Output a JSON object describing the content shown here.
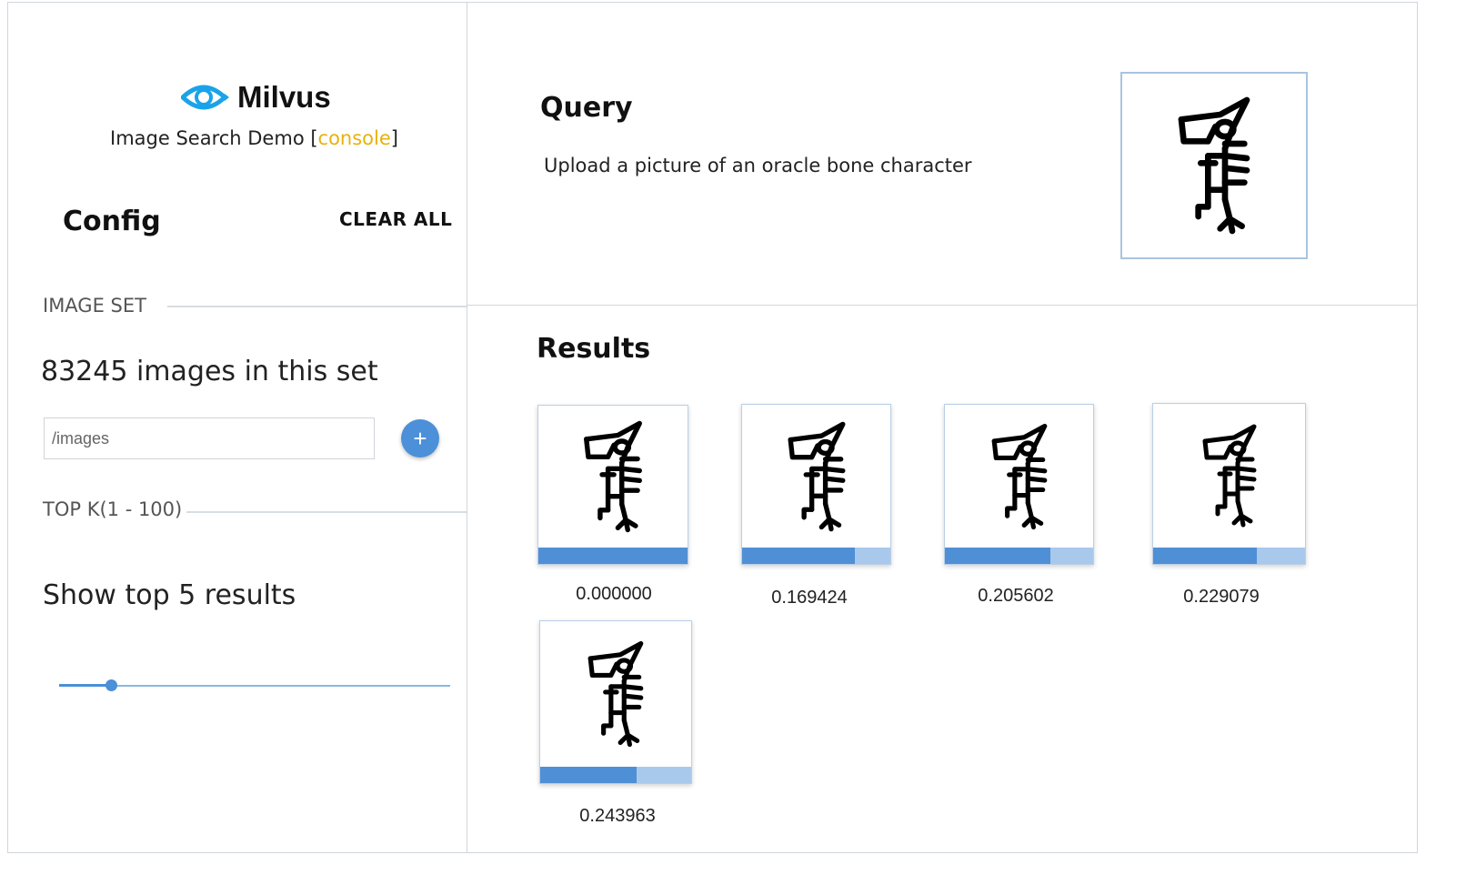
{
  "app": {
    "brand": "Milvus",
    "subtitle_prefix": "Image Search Demo [",
    "subtitle_link": "console",
    "subtitle_suffix": "]"
  },
  "sidebar": {
    "config_title": "Config",
    "clear_all_label": "CLEAR ALL",
    "image_set_label": "IMAGE SET",
    "image_count_text": "83245 images in this set",
    "path_input_value": "/images",
    "add_button_label": "+",
    "topk_label": "TOP K(1 - 100)",
    "topk_text": "Show top 5 results",
    "topk_value": 5,
    "topk_min": 1,
    "topk_max": 100
  },
  "query": {
    "title": "Query",
    "description": "Upload a picture of an oracle bone character",
    "image_icon": "oracle-bone-character"
  },
  "results": {
    "title": "Results",
    "items": [
      {
        "score": "0.000000",
        "bar_fraction": 1.0
      },
      {
        "score": "0.169424",
        "bar_fraction": 0.76
      },
      {
        "score": "0.205602",
        "bar_fraction": 0.71
      },
      {
        "score": "0.229079",
        "bar_fraction": 0.68
      },
      {
        "score": "0.243963",
        "bar_fraction": 0.64
      }
    ]
  },
  "colors": {
    "accent": "#4b90d9",
    "console_link": "#e8b10e",
    "bar_fill": "#4f8fd6",
    "bar_bg": "#a9c9ec"
  }
}
